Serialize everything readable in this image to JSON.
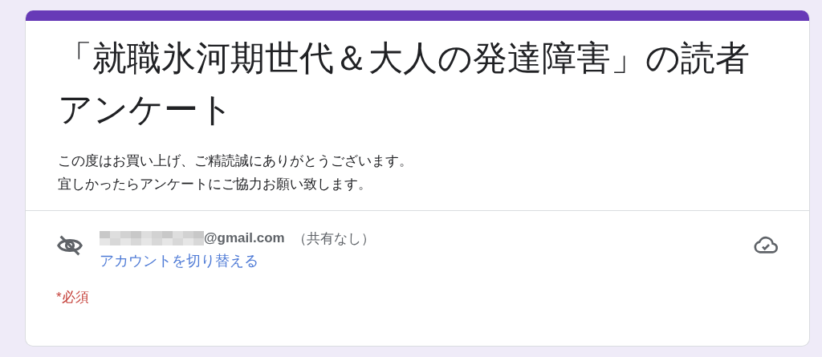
{
  "form": {
    "title": "「就職氷河期世代＆大人の発達障害」の読者アンケート",
    "description": [
      "この度はお買い上げ、ご精読誠にありがとうございます。",
      "宜しかったらアンケートにご協力お願い致します。"
    ],
    "account": {
      "email": "@gmail.com",
      "sharing": "（共有なし）",
      "switch_link": "アカウントを切り替える"
    },
    "required_note": "*必須"
  }
}
